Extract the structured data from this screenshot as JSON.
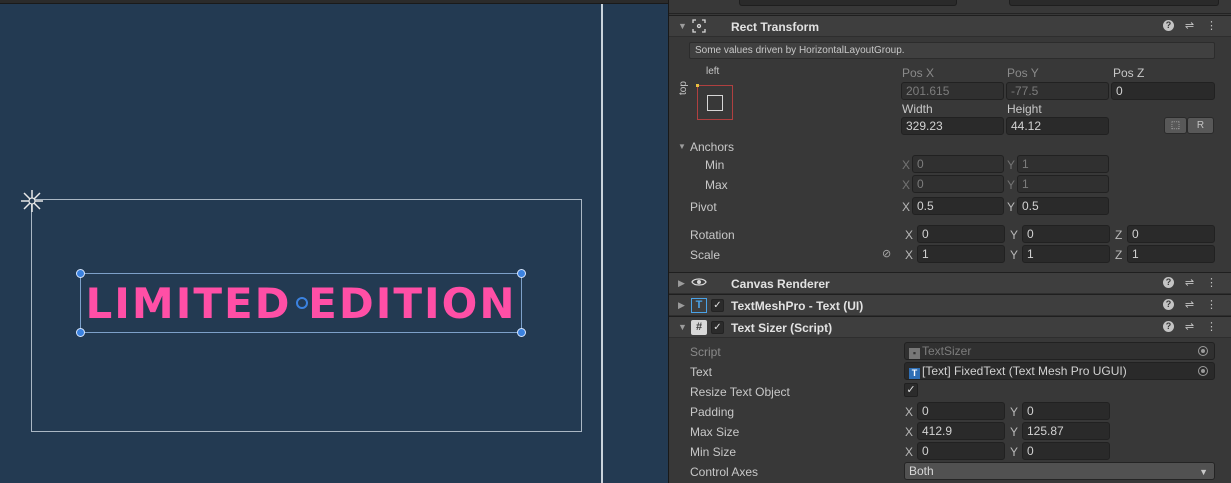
{
  "scene": {
    "text_preview": "LIMITED EDITION"
  },
  "rect_transform": {
    "title": "Rect Transform",
    "help_message": "Some values driven by HorizontalLayoutGroup.",
    "anchor_preset": {
      "horizontal": "left",
      "vertical": "top"
    },
    "pos_x": {
      "label": "Pos X",
      "value": "201.615"
    },
    "pos_y": {
      "label": "Pos Y",
      "value": "-77.5"
    },
    "pos_z": {
      "label": "Pos Z",
      "value": "0"
    },
    "width": {
      "label": "Width",
      "value": "329.23"
    },
    "height": {
      "label": "Height",
      "value": "44.12"
    },
    "raw_button": "R",
    "anchors": {
      "label": "Anchors",
      "min": {
        "label": "Min",
        "x": "0",
        "y": "1"
      },
      "max": {
        "label": "Max",
        "x": "0",
        "y": "1"
      }
    },
    "pivot": {
      "label": "Pivot",
      "x": "0.5",
      "y": "0.5"
    },
    "rotation": {
      "label": "Rotation",
      "x": "0",
      "y": "0",
      "z": "0"
    },
    "scale": {
      "label": "Scale",
      "x": "1",
      "y": "1",
      "z": "1"
    },
    "axis_labels": {
      "x": "X",
      "y": "Y",
      "z": "Z"
    }
  },
  "canvas_renderer": {
    "title": "Canvas Renderer"
  },
  "textmeshpro": {
    "title": "TextMeshPro - Text (UI)",
    "enabled": true
  },
  "text_sizer": {
    "title": "Text Sizer (Script)",
    "enabled": true,
    "script": {
      "label": "Script",
      "value": "TextSizer"
    },
    "text": {
      "label": "Text",
      "value": "[Text] FixedText (Text Mesh Pro UGUI)"
    },
    "resize_text_object": {
      "label": "Resize Text Object",
      "checked": true
    },
    "padding": {
      "label": "Padding",
      "x": "0",
      "y": "0"
    },
    "max_size": {
      "label": "Max Size",
      "x": "412.9",
      "y": "125.87"
    },
    "min_size": {
      "label": "Min Size",
      "x": "0",
      "y": "0"
    },
    "control_axes": {
      "label": "Control Axes",
      "value": "Both"
    }
  },
  "icons": {
    "rect_transform": "rect-transform-icon",
    "canvas_renderer": "eye-icon",
    "textmeshpro": "tmp-text-icon",
    "text_sizer": "script-hash-icon",
    "help": "help-icon",
    "preset": "preset-sliders-icon",
    "menu": "kebab-menu-icon",
    "constrain": "constrain-proportions-icon",
    "blueprint": "blueprint-mode-icon"
  },
  "colors": {
    "scene_bg": "#233a52",
    "text_pink": "#ff4fa6",
    "selection_blue": "#3b82e0",
    "inspector_bg": "#383838"
  }
}
